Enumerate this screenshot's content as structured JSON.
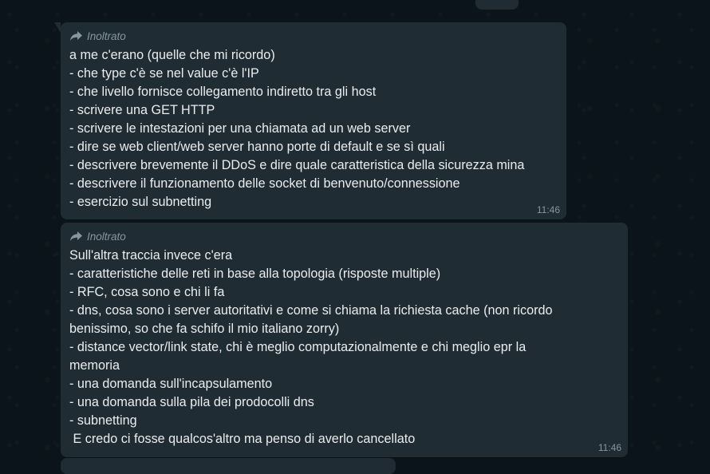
{
  "chat": {
    "messages": [
      {
        "forwarded_label": "Inoltrato",
        "time": "11:46",
        "lines": [
          "a me c'erano (quelle che mi ricordo)",
          "- che type c'è se nel value c'è l'IP",
          "- che livello fornisce collegamento indiretto tra gli host",
          "- scrivere una GET HTTP",
          "- scrivere le intestazioni per una chiamata ad un web server",
          "- dire se web client/web server hanno porte di default e se sì quali",
          "- descrivere brevemente il DDoS e dire quale caratteristica della sicurezza mina",
          "- descrivere il funzionamento delle socket di benvenuto/connessione",
          "- esercizio sul subnetting"
        ]
      },
      {
        "forwarded_label": "Inoltrato",
        "time": "11:46",
        "lines": [
          "Sull'altra traccia invece c'era",
          "- caratteristiche delle reti in base alla topologia (risposte multiple)",
          "- RFC, cosa sono e chi li fa",
          "- dns, cosa sono i server autoritativi e come si chiama la richiesta cache (non ricordo",
          "benissimo, so che fa schifo il mio italiano zorry)",
          "- distance vector/link state, chi è meglio computazionalmente e chi meglio epr la",
          "memoria",
          "- una domanda sull'incapsulamento",
          "- una domanda sulla pila dei prodocolli dns",
          "- subnetting",
          " E credo ci fosse qualcos'altro ma penso di averlo cancellato"
        ]
      }
    ]
  },
  "colors": {
    "background": "#0b141a",
    "bubble": "#202c33",
    "text": "#e9edef",
    "meta": "#8696a0"
  },
  "icons": {
    "forward": "forward-arrow-icon"
  }
}
